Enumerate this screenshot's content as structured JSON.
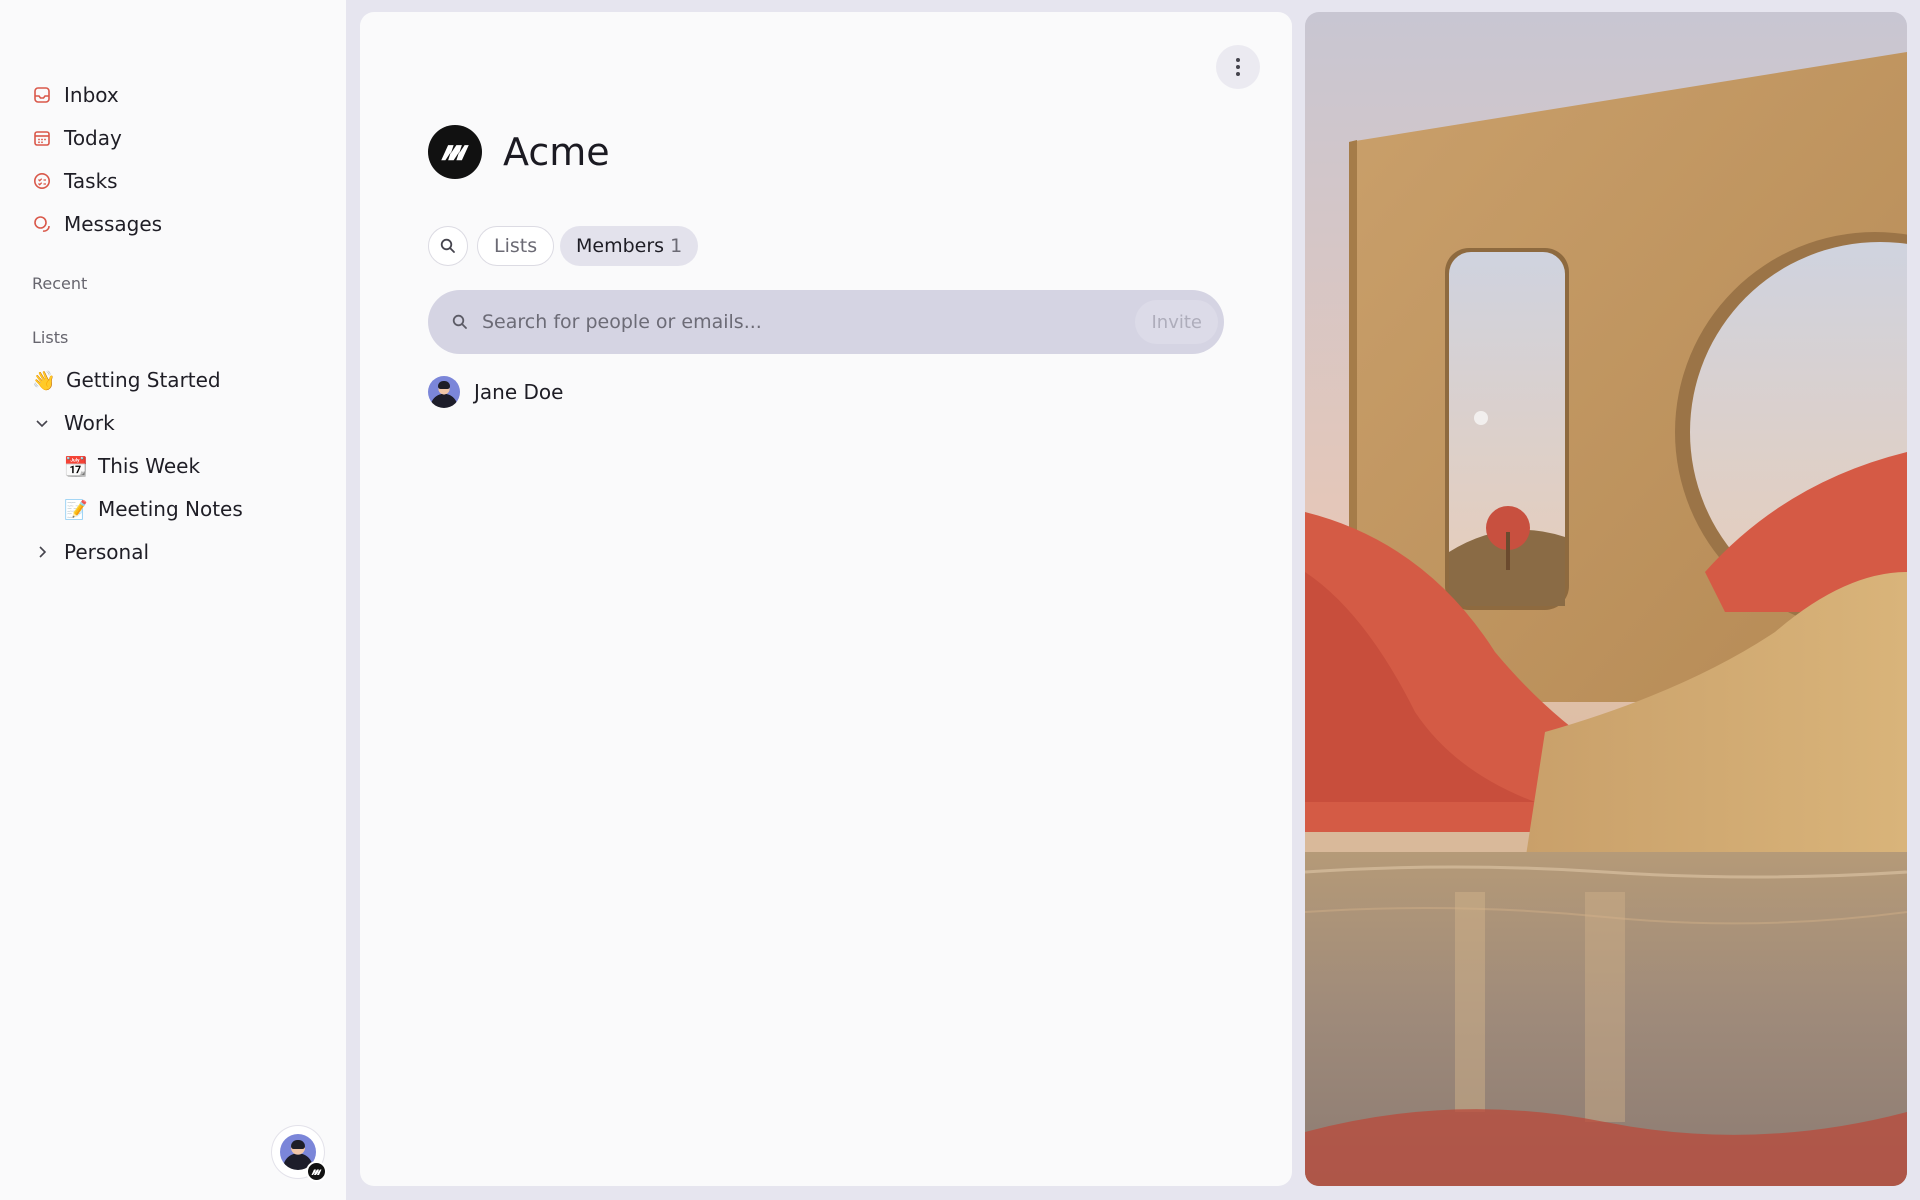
{
  "sidebar": {
    "nav": [
      {
        "label": "Inbox",
        "icon": "inbox-icon"
      },
      {
        "label": "Today",
        "icon": "calendar-icon"
      },
      {
        "label": "Tasks",
        "icon": "tasks-icon"
      },
      {
        "label": "Messages",
        "icon": "messages-icon"
      }
    ],
    "recent_label": "Recent",
    "lists_label": "Lists",
    "lists": [
      {
        "label": "Getting Started",
        "emoji": "👋"
      },
      {
        "label": "Work",
        "expanded": true
      },
      {
        "label": "This Week",
        "emoji": "📆"
      },
      {
        "label": "Meeting Notes",
        "emoji": "📝"
      },
      {
        "label": "Personal",
        "expanded": false
      }
    ]
  },
  "main": {
    "org_name": "Acme",
    "tabs": {
      "lists": "Lists",
      "members": "Members",
      "members_count": "1"
    },
    "search": {
      "placeholder": "Search for people or emails...",
      "invite_label": "Invite"
    },
    "members": [
      {
        "name": "Jane Doe"
      }
    ]
  },
  "colors": {
    "accent_icon": "#d9584a",
    "search_bg": "#d5d4e3",
    "tab_active_bg": "#e3e2ec"
  }
}
